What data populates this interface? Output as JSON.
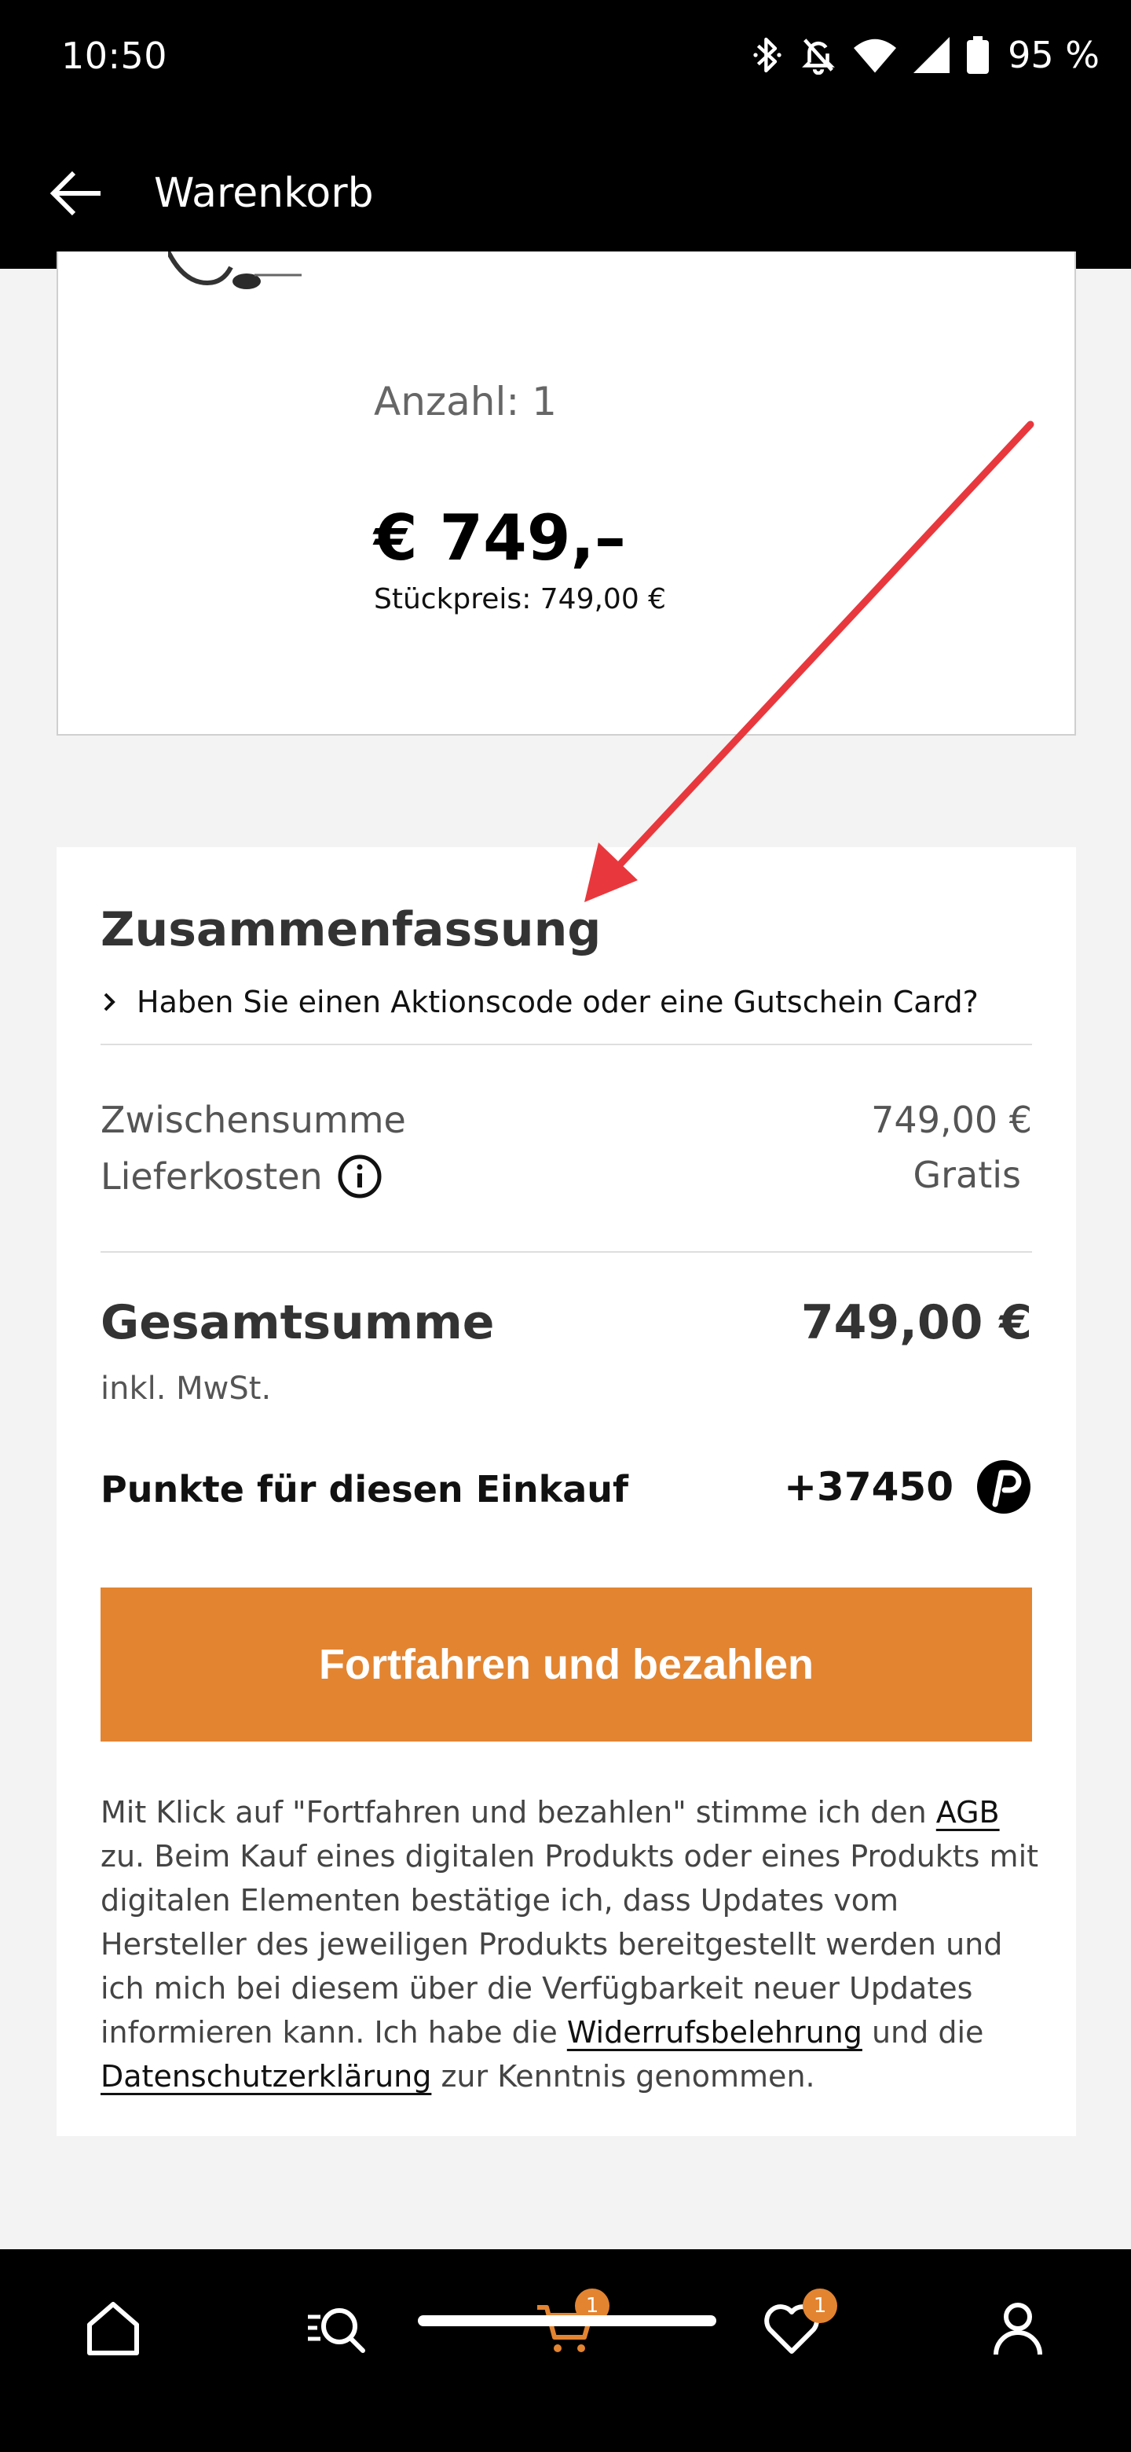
{
  "status_bar": {
    "time": "10:50",
    "battery": "95 %",
    "icons": [
      "bluetooth-icon",
      "bell-off-icon",
      "wifi-icon",
      "signal-icon",
      "battery-icon"
    ]
  },
  "app_bar": {
    "title": "Warenkorb",
    "back_icon": "arrow-left-icon"
  },
  "product": {
    "quantity": "Anzahl: 1",
    "price": "€ 749,–",
    "unit_price": "Stückpreis: 749,00 €"
  },
  "summary": {
    "title": "Zusammenfassung",
    "promo_text": "Haben Sie einen Aktionscode oder eine Gutschein Card?",
    "subtotal_label": "Zwischensumme",
    "subtotal_value": "749,00 €",
    "shipping_label": "Lieferkosten",
    "shipping_value": "Gratis",
    "total_label": "Gesamtsumme",
    "total_value": "749,00 €",
    "vat_note": "inkl. MwSt.",
    "points_label": "Punkte für diesen Einkauf",
    "points_value": "+37450",
    "cta_label": "Fortfahren und bezahlen"
  },
  "legal": {
    "part1": "Mit Klick auf \"Fortfahren und bezahlen\" stimme ich den ",
    "agb": "AGB",
    "part2": " zu. Beim Kauf eines digitalen Produkts oder eines Produkts mit digitalen Elementen bestätige ich, dass Updates vom Hersteller des jeweiligen Produkts bereitgestellt werden und ich mich bei diesem über die Verfügbarkeit neuer Updates informieren kann. Ich habe die ",
    "widerruf": "Widerrufsbelehrung",
    "part3": " und die ",
    "datenschutz": "Datenschutzerklärung",
    "part4": " zur Kenntnis genommen."
  },
  "bottom_nav": {
    "items": [
      "home-icon",
      "search-icon",
      "cart-icon",
      "wishlist-icon",
      "account-icon"
    ],
    "cart_badge": "1",
    "wishlist_badge": "1"
  },
  "colors": {
    "accent": "#e38431",
    "annotation_arrow": "#e8383d"
  }
}
